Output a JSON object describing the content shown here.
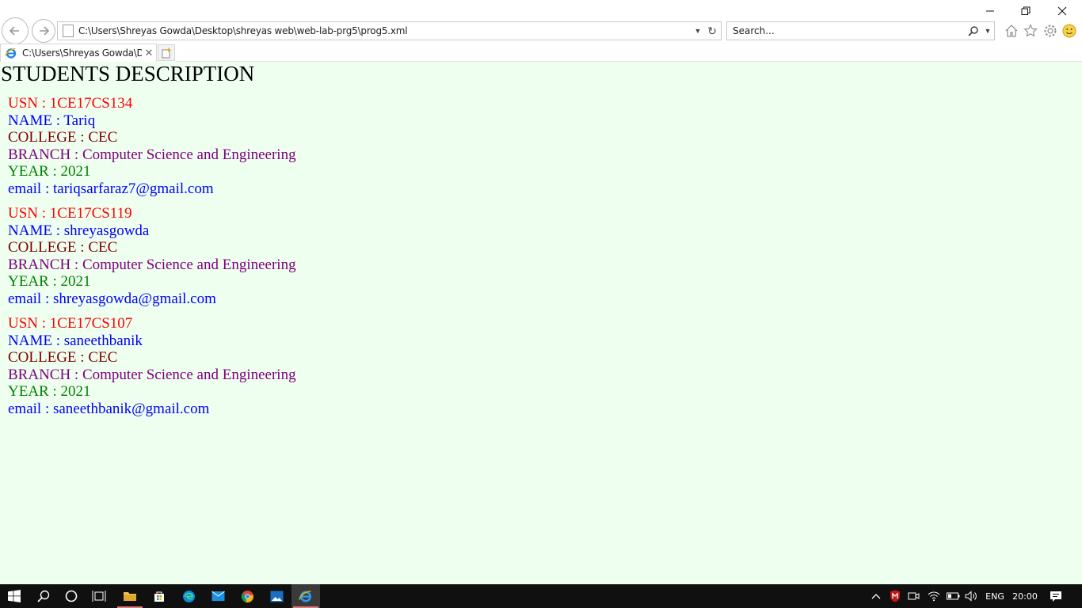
{
  "browser": {
    "address": "C:\\Users\\Shreyas Gowda\\Desktop\\shreyas web\\web-lab-prg5\\prog5.xml",
    "search_placeholder": "Search...",
    "tab_title": "C:\\Users\\Shreyas Gowda\\D..."
  },
  "page": {
    "title": "STUDENTS DESCRIPTION",
    "students": [
      {
        "usn": "USN : 1CE17CS134",
        "name": "NAME : Tariq",
        "college": "COLLEGE : CEC",
        "branch": "BRANCH : Computer Science and Engineering",
        "year": "YEAR : 2021",
        "email": "email : tariqsarfaraz7@gmail.com"
      },
      {
        "usn": "USN : 1CE17CS119",
        "name": "NAME : shreyasgowda",
        "college": "COLLEGE : CEC",
        "branch": "BRANCH : Computer Science and Engineering",
        "year": "YEAR : 2021",
        "email": "email : shreyasgowda@gmail.com"
      },
      {
        "usn": "USN : 1CE17CS107",
        "name": "NAME : saneethbanik",
        "college": "COLLEGE : CEC",
        "branch": "BRANCH : Computer Science and Engineering",
        "year": "YEAR : 2021",
        "email": "email : saneethbanik@gmail.com"
      }
    ],
    "colors": {
      "background": "#efffef",
      "usn": "#ff0000",
      "name": "#0000ff",
      "college": "#800000",
      "branch": "#800080",
      "year": "#008000",
      "email": "#0000ff"
    }
  },
  "taskbar": {
    "apps": [
      "start-icon",
      "search-icon",
      "cortana-icon",
      "task-view-icon",
      "file-explorer-icon",
      "store-icon",
      "edge-icon",
      "mail-icon",
      "chrome-icon",
      "photos-icon",
      "internet-explorer-icon"
    ],
    "language": "ENG",
    "time": "20:00"
  }
}
